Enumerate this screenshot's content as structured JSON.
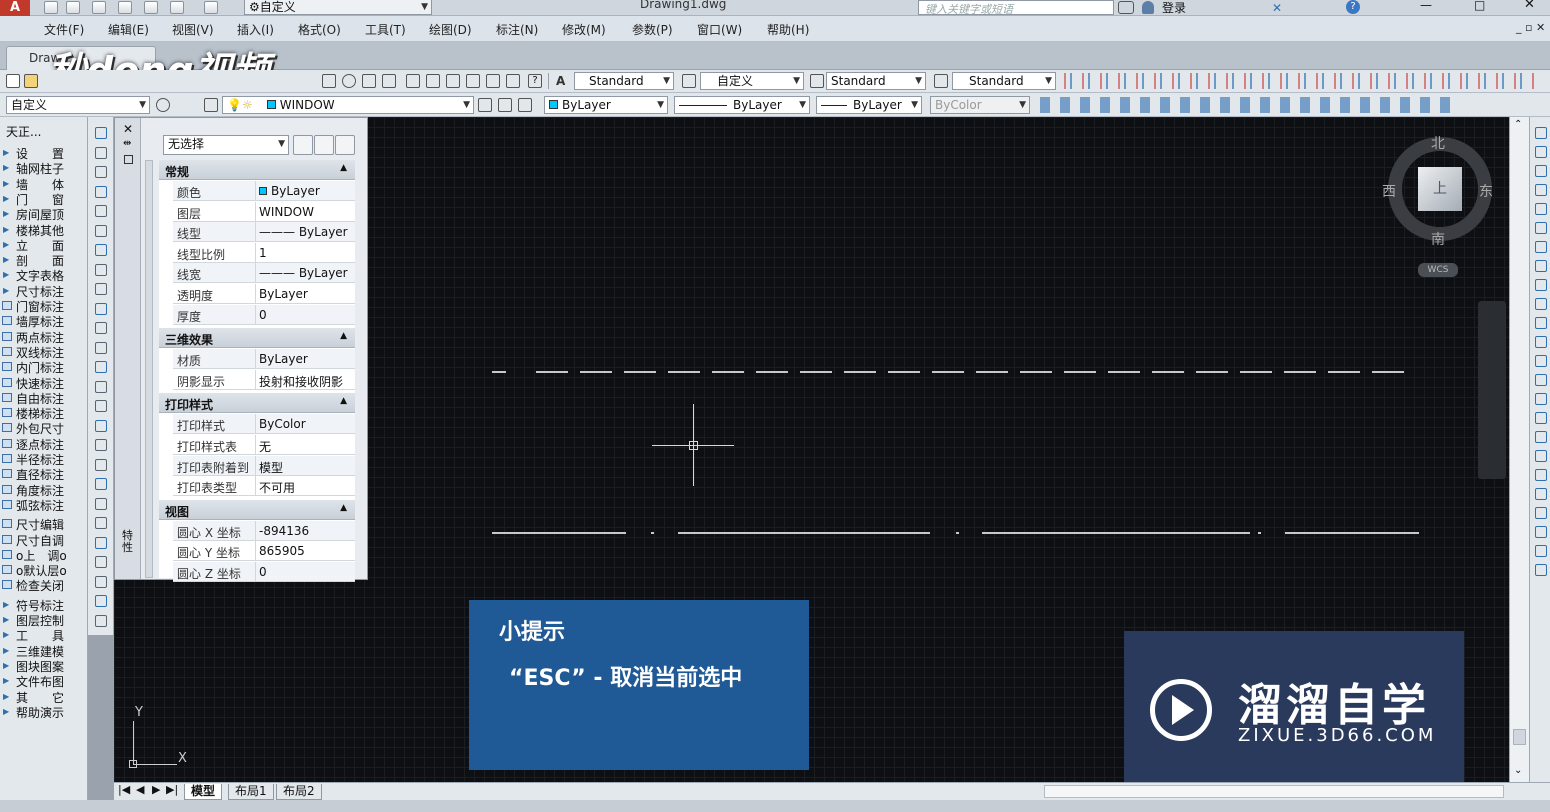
{
  "app": {
    "file_title": "Drawing1.dwg",
    "search_placeholder": "键入关键字或短语",
    "login": "登录",
    "workspace": "自定义"
  },
  "menu": [
    "文件(F)",
    "编辑(E)",
    "视图(V)",
    "插入(I)",
    "格式(O)",
    "工具(T)",
    "绘图(D)",
    "标注(N)",
    "修改(M)",
    "参数(P)",
    "窗口(W)",
    "帮助(H)"
  ],
  "doc_tab": "Draw",
  "watermark": "秒dong视频",
  "toolbar1": {
    "text_style": "Standard",
    "dim_style": "自定义",
    "table_style": "Standard",
    "multileader_style": "Standard"
  },
  "toolbar2": {
    "workspace": "自定义",
    "layer": "WINDOW",
    "color": "ByLayer",
    "linetype": "ByLayer",
    "lineweight": "ByLayer",
    "plotstyle": "ByColor"
  },
  "left_panel": {
    "title": "天正...",
    "items": [
      "设　　置",
      "轴网柱子",
      "墙　　体",
      "门　　窗",
      "房间屋顶",
      "楼梯其他",
      "立　　面",
      "剖　　面",
      "文字表格",
      "尺寸标注",
      "门窗标注",
      "墙厚标注",
      "两点标注",
      "双线标注",
      "内门标注",
      "快速标注",
      "自由标注",
      "楼梯标注",
      "外包尺寸",
      "逐点标注",
      "半径标注",
      "直径标注",
      "角度标注",
      "弧弦标注",
      "尺寸编辑",
      "尺寸自调",
      "o上　调o",
      "o默认层o",
      "检查关闭",
      "符号标注",
      "图层控制",
      "工　　具",
      "三维建模",
      "图块图案",
      "文件布图",
      "其　　它",
      "帮助演示"
    ]
  },
  "properties": {
    "selection": "无选择",
    "strip_label": "特性",
    "sections": [
      {
        "title": "常规",
        "rows": [
          {
            "key": "颜色",
            "value": "ByLayer"
          },
          {
            "key": "图层",
            "value": "WINDOW"
          },
          {
            "key": "线型",
            "value": "——— ByLayer"
          },
          {
            "key": "线型比例",
            "value": "1"
          },
          {
            "key": "线宽",
            "value": "——— ByLayer"
          },
          {
            "key": "透明度",
            "value": "ByLayer"
          },
          {
            "key": "厚度",
            "value": "0"
          }
        ]
      },
      {
        "title": "三维效果",
        "rows": [
          {
            "key": "材质",
            "value": "ByLayer"
          },
          {
            "key": "阴影显示",
            "value": "投射和接收阴影"
          }
        ]
      },
      {
        "title": "打印样式",
        "rows": [
          {
            "key": "打印样式",
            "value": "ByColor"
          },
          {
            "key": "打印样式表",
            "value": "无"
          },
          {
            "key": "打印表附着到",
            "value": "模型"
          },
          {
            "key": "打印表类型",
            "value": "不可用"
          }
        ]
      },
      {
        "title": "视图",
        "rows": [
          {
            "key": "圆心 X 坐标",
            "value": "-894136"
          },
          {
            "key": "圆心 Y 坐标",
            "value": "865905"
          },
          {
            "key": "圆心 Z 坐标",
            "value": "0"
          }
        ]
      }
    ]
  },
  "viewcube": {
    "north": "北",
    "south": "南",
    "east": "东",
    "west": "西",
    "face": "上",
    "wcs": "WCS"
  },
  "ucs": {
    "x": "X",
    "y": "Y"
  },
  "layout_tabs": [
    "模型",
    "布局1",
    "布局2"
  ],
  "tip": {
    "title": "小提示",
    "text": "“ESC” - 取消当前选中"
  },
  "brand": {
    "name": "溜溜自学",
    "url": "ZIXUE.3D66.COM"
  },
  "colors": {
    "canvas": "#0d0f12",
    "tip_bg": "#1f5a96",
    "brand_bg": "#2a3a5c",
    "accent": "#2d6fb0"
  }
}
